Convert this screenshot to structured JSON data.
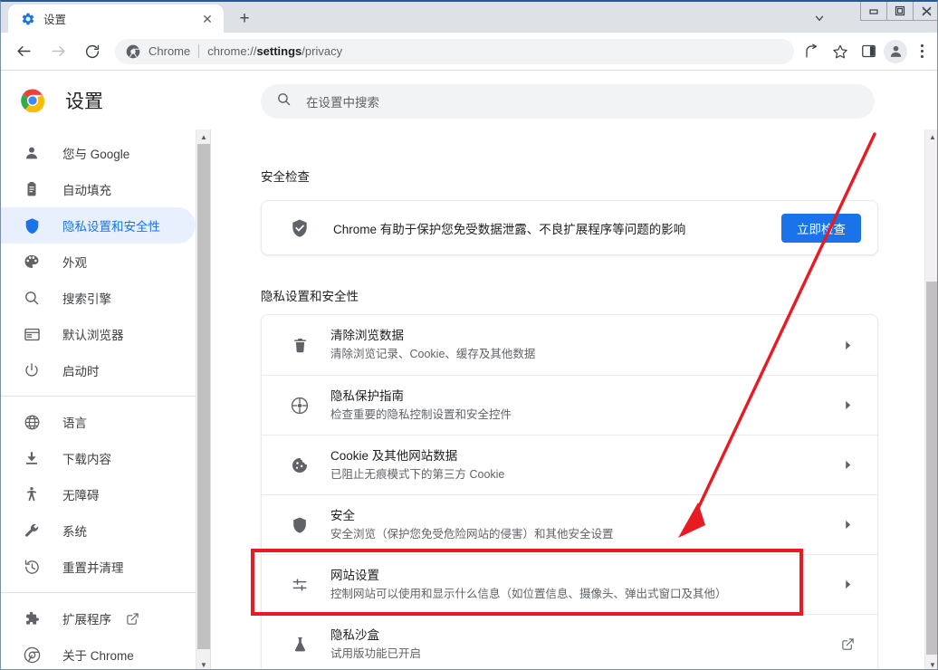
{
  "window": {
    "minimize_label": "—",
    "maximize_label": "▣",
    "close_label": "✕"
  },
  "tabstrip": {
    "tab_title": "设置",
    "tab_favicon_icon": "gear-icon",
    "close_label": "✕",
    "newtab_label": "+",
    "tab_search_icon": "chevron-down-icon"
  },
  "toolbar": {
    "back_icon": "arrow-left-icon",
    "forward_icon": "arrow-right-icon",
    "reload_icon": "reload-icon",
    "site_icon": "chrome-icon",
    "site_label": "Chrome",
    "url_prefix": "chrome://",
    "url_bold": "settings",
    "url_suffix": "/privacy",
    "url_full": "chrome://settings/privacy",
    "share_icon": "share-icon",
    "bookmark_icon": "star-icon",
    "sidepanel_icon": "side-panel-icon",
    "profile_icon": "person-icon",
    "menu_icon": "three-dot-menu-icon"
  },
  "settings_header": {
    "logo_icon": "chrome-logo-icon",
    "title": "设置",
    "search_icon": "search-icon",
    "search_placeholder": "在设置中搜索",
    "search_value": ""
  },
  "sidebar": {
    "group_one": [
      {
        "label": "您与 Google",
        "icon": "person-icon",
        "active": false
      },
      {
        "label": "自动填充",
        "icon": "clipboard-icon",
        "active": false
      },
      {
        "label": "隐私设置和安全性",
        "icon": "shield-icon",
        "active": true
      },
      {
        "label": "外观",
        "icon": "palette-icon",
        "active": false
      },
      {
        "label": "搜索引擎",
        "icon": "search-icon",
        "active": false
      },
      {
        "label": "默认浏览器",
        "icon": "browser-window-icon",
        "active": false
      },
      {
        "label": "启动时",
        "icon": "power-icon",
        "active": false
      }
    ],
    "group_two": [
      {
        "label": "语言",
        "icon": "globe-icon"
      },
      {
        "label": "下载内容",
        "icon": "download-icon"
      },
      {
        "label": "无障碍",
        "icon": "accessibility-icon"
      },
      {
        "label": "系统",
        "icon": "wrench-icon"
      },
      {
        "label": "重置并清理",
        "icon": "history-restore-icon"
      }
    ],
    "group_three": [
      {
        "label": "扩展程序",
        "icon": "puzzle-piece-icon",
        "external": true
      },
      {
        "label": "关于 Chrome",
        "icon": "chrome-icon",
        "external": false
      }
    ]
  },
  "main": {
    "safety_check": {
      "heading": "安全检查",
      "shield_icon": "shield-check-icon",
      "description": "Chrome 有助于保护您免受数据泄露、不良扩展程序等问题的影响",
      "button_label": "立即检查",
      "button_color": "#1a73e8"
    },
    "privacy_heading": "隐私设置和安全性",
    "privacy_rows": [
      {
        "icon": "trash-icon",
        "title": "清除浏览数据",
        "subtitle": "清除浏览记录、Cookie、缓存及其他数据",
        "trailing": "chevron-right-icon"
      },
      {
        "icon": "privacy-guide-icon",
        "title": "隐私保护指南",
        "subtitle": "检查重要的隐私控制设置和安全控件",
        "trailing": "chevron-right-icon"
      },
      {
        "icon": "cookie-icon",
        "title": "Cookie 及其他网站数据",
        "subtitle": "已阻止无痕模式下的第三方 Cookie",
        "trailing": "chevron-right-icon"
      },
      {
        "icon": "shield-icon",
        "title": "安全",
        "subtitle": "安全浏览（保护您免受危险网站的侵害）和其他安全设置",
        "trailing": "chevron-right-icon"
      },
      {
        "icon": "sliders-icon",
        "title": "网站设置",
        "subtitle": "控制网站可以使用和显示什么信息（如位置信息、摄像头、弹出式窗口及其他）",
        "trailing": "chevron-right-icon"
      },
      {
        "icon": "flask-icon",
        "title": "隐私沙盒",
        "subtitle": "试用版功能已开启",
        "trailing": "external-link-icon"
      }
    ]
  },
  "annotations": {
    "highlight_color": "#e81b23",
    "highlight_target": "网站设置",
    "arrow_color": "#e81b23"
  }
}
